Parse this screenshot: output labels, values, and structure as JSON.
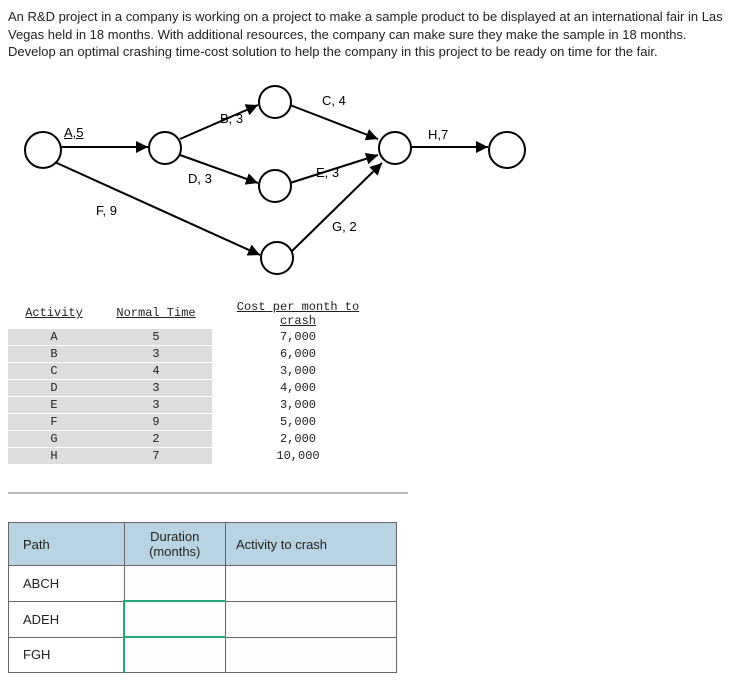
{
  "intro": "An R&D project in a company is working on a project to make a sample product to be displayed at an international fair in Las Vegas held in 18 months. With additional resources, the company can make sure they make the sample in 18 months. Develop an optimal crashing time-cost solution to help the company in this project to be ready on time for the fair.",
  "edges": {
    "A": "A,5",
    "B": "B, 3",
    "C": "C, 4",
    "D": "D, 3",
    "E": "E, 3",
    "F": "F, 9",
    "G": "G, 2",
    "H": "H,7"
  },
  "table": {
    "headers": {
      "activity": "Activity",
      "normal": "Normal Time",
      "cost": "Cost per month to crash"
    },
    "rows": [
      {
        "act": "A",
        "nt": "5",
        "cost": "7,000"
      },
      {
        "act": "B",
        "nt": "3",
        "cost": "6,000"
      },
      {
        "act": "C",
        "nt": "4",
        "cost": "3,000"
      },
      {
        "act": "D",
        "nt": "3",
        "cost": "4,000"
      },
      {
        "act": "E",
        "nt": "3",
        "cost": "3,000"
      },
      {
        "act": "F",
        "nt": "9",
        "cost": "5,000"
      },
      {
        "act": "G",
        "nt": "2",
        "cost": "2,000"
      },
      {
        "act": "H",
        "nt": "7",
        "cost": "10,000"
      }
    ]
  },
  "path_table": {
    "headers": {
      "path": "Path",
      "duration": "Duration (months)",
      "crash": "Activity to crash"
    },
    "rows": [
      {
        "path": "ABCH"
      },
      {
        "path": "ADEH"
      },
      {
        "path": "FGH"
      }
    ]
  }
}
